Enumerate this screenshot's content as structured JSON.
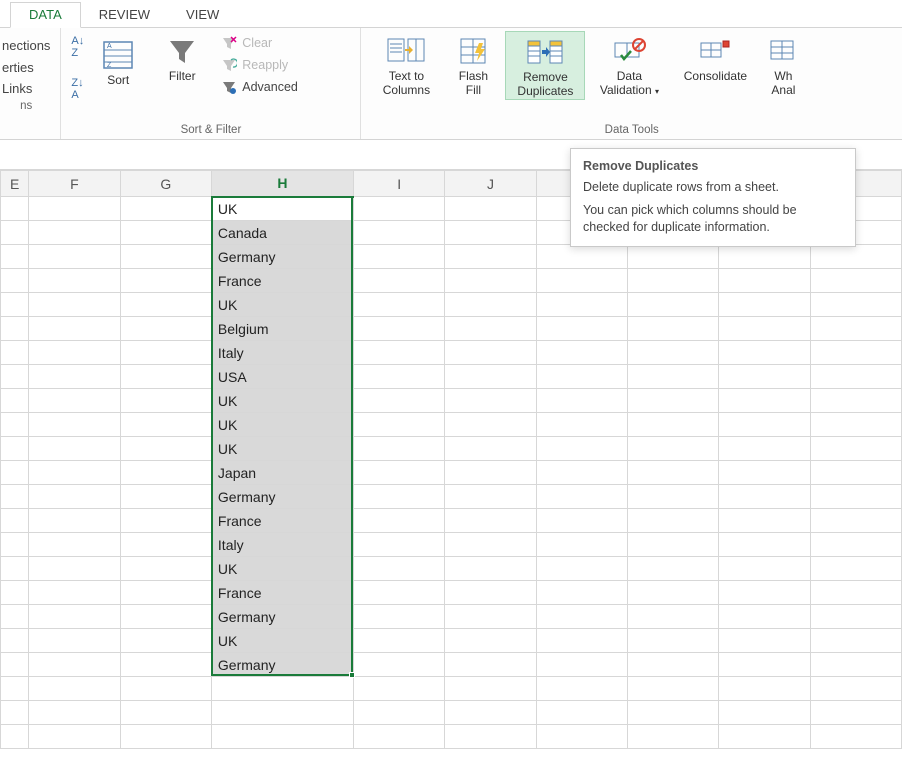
{
  "ribbon": {
    "tabs": [
      "DATA",
      "REVIEW",
      "VIEW"
    ],
    "active_tab": "DATA",
    "connections": {
      "a": "nections",
      "b": "erties",
      "c": "Links",
      "d": "ns"
    },
    "sort_filter": {
      "sort": "Sort",
      "filter": "Filter",
      "clear": "Clear",
      "reapply": "Reapply",
      "advanced": "Advanced",
      "group": "Sort & Filter"
    },
    "data_tools": {
      "text_to_columns": "Text to\nColumns",
      "flash_fill": "Flash\nFill",
      "remove_dup": "Remove\nDuplicates",
      "data_validation": "Data\nValidation",
      "consolidate": "Consolidate",
      "what_if": "Wh\nAnal",
      "group": "Data Tools"
    }
  },
  "tooltip": {
    "title": "Remove Duplicates",
    "line1": "Delete duplicate rows from a sheet.",
    "line2": "You can pick which columns should be checked for duplicate information."
  },
  "columns": [
    "E",
    "F",
    "G",
    "H",
    "I",
    "J",
    "",
    "",
    "",
    ""
  ],
  "h_data": [
    "UK",
    "Canada",
    "Germany",
    "France",
    "UK",
    "Belgium",
    "Italy",
    "USA",
    "UK",
    "UK",
    "UK",
    "Japan",
    "Germany",
    "France",
    "Italy",
    "UK",
    "France",
    "Germany",
    "UK",
    "Germany"
  ]
}
